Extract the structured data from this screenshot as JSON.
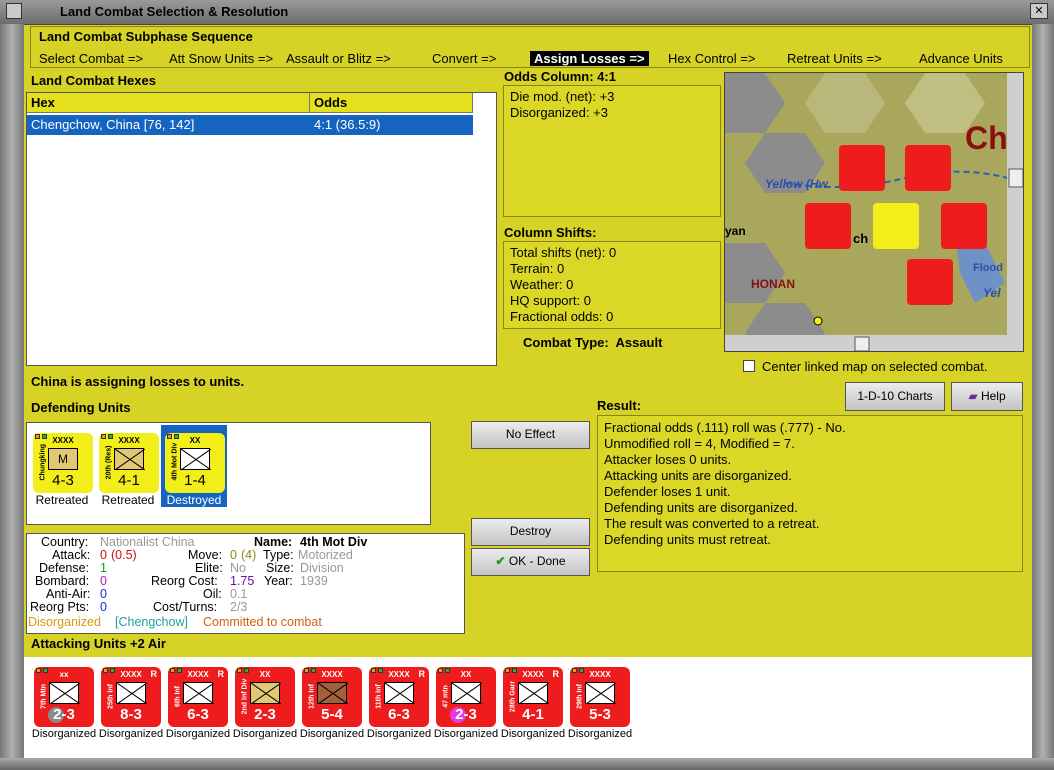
{
  "window": {
    "title": "Land Combat Selection & Resolution"
  },
  "phase": {
    "title": "Land Combat Subphase Sequence",
    "steps": [
      "Select Combat =>",
      "Att Snow Units =>",
      "Assault or Blitz =>",
      "Convert =>",
      "Assign Losses =>",
      "Hex Control =>",
      "Retreat Units =>",
      "Advance Units"
    ],
    "active_index": 4
  },
  "hexes": {
    "title": "Land Combat Hexes",
    "col_hex": "Hex",
    "col_odds": "Odds",
    "row": {
      "hex": "Chengchow, China [76, 142]",
      "odds": "4:1 (36.5:9)"
    }
  },
  "odds": {
    "title": "Odds Column: 4:1",
    "lines": [
      "Die mod. (net): +3",
      "Disorganized: +3"
    ]
  },
  "shifts": {
    "title": "Column Shifts:",
    "lines": [
      "Total shifts (net): 0",
      "Terrain: 0",
      "Weather: 0",
      "HQ support: 0",
      "Fractional odds: 0"
    ]
  },
  "combat_type": {
    "label": "Combat Type:",
    "value": "Assault"
  },
  "map": {
    "labels": [
      "Yellow (Hw",
      "HONAN",
      "Flood",
      "ch",
      "yan",
      "Yel",
      "Ch"
    ],
    "center_checkbox": "Center linked map on selected combat.",
    "center_checked": false
  },
  "status": "China is assigning losses to units.",
  "defending": {
    "title": "Defending Units",
    "units": [
      {
        "name": "Chungking",
        "size": "XXXX",
        "symbol": "M",
        "value": "4-3",
        "status": "Retreated",
        "selected": false
      },
      {
        "name": "20th (Res)",
        "size": "XXXX",
        "symbol": "",
        "value": "4-1",
        "status": "Retreated",
        "selected": false
      },
      {
        "name": "4th Mot Div",
        "size": "XX",
        "symbol": "",
        "value": "1-4",
        "status": "Destroyed",
        "selected": true
      }
    ]
  },
  "buttons": {
    "no_effect": "No Effect",
    "destroy": "Destroy",
    "ok_done": "OK - Done",
    "charts": "1-D-10 Charts",
    "help": "Help"
  },
  "result": {
    "title": "Result:",
    "lines": [
      "Fractional odds (.111) roll was (.777)  - No.",
      "Unmodified roll = 4, Modified = 7.",
      "Attacker loses 0 units.",
      "Attacking units are disorganized.",
      "Defender loses 1 unit.",
      "Defending units are disorganized.",
      "The result was converted to a retreat.",
      "Defending units must retreat."
    ]
  },
  "details": {
    "country_label": "Country:",
    "country": "Nationalist China",
    "name_label": "Name:",
    "name": "4th Mot Div",
    "attack_label": "Attack:",
    "attack": "0",
    "attack_paren": "(0.5)",
    "move_label": "Move:",
    "move": "0",
    "move_paren": "(4)",
    "type_label": "Type:",
    "type": "Motorized",
    "defense_label": "Defense:",
    "defense": "1",
    "elite_label": "Elite:",
    "elite": "No",
    "size_label": "Size:",
    "size": "Division",
    "bombard_label": "Bombard:",
    "bombard": "0",
    "reorg_label": "Reorg Cost:",
    "reorg": "1.75",
    "year_label": "Year:",
    "year": "1939",
    "antiair_label": "Anti-Air:",
    "antiair": "0",
    "oil_label": "Oil:",
    "oil": "0.1",
    "reorgpts_label": "Reorg Pts:",
    "reorgpts": "0",
    "cost_label": "Cost/Turns:",
    "cost": "2/3",
    "footer_a": "Disorganized",
    "footer_b": "[Chengchow]",
    "footer_c": "Committed to combat"
  },
  "attacking": {
    "title": "Attacking Units +2 Air",
    "units": [
      {
        "name": "7th Mtn",
        "size": "xx",
        "value": "2-3",
        "box": "white",
        "status": "Disorganized",
        "badge": "grey"
      },
      {
        "name": "25th Inf",
        "size": "XXXX",
        "value": "8-3",
        "box": "white",
        "status": "Disorganized",
        "r": "R"
      },
      {
        "name": "6th Inf",
        "size": "XXXX",
        "value": "6-3",
        "box": "white",
        "status": "Disorganized",
        "r": "R"
      },
      {
        "name": "2nd Inf Div",
        "size": "XX",
        "value": "2-3",
        "box": "tan",
        "status": "Disorganized"
      },
      {
        "name": "12th Inf",
        "size": "XXXX",
        "value": "5-4",
        "box": "brown",
        "status": "Disorganized"
      },
      {
        "name": "11th Inf",
        "size": "XXXX",
        "value": "6-3",
        "box": "white",
        "status": "Disorganized",
        "r": "R"
      },
      {
        "name": "47 mtn",
        "size": "XX",
        "value": "2-3",
        "box": "white",
        "status": "Disorganized",
        "badge": "pink"
      },
      {
        "name": "28th Garr",
        "size": "XXXX",
        "value": "4-1",
        "box": "white",
        "status": "Disorganized",
        "r": "R"
      },
      {
        "name": "29th Inf",
        "size": "XXXX",
        "value": "5-3",
        "box": "white",
        "status": "Disorganized"
      }
    ]
  },
  "colors": {
    "panel": "#d7d226",
    "select": "#1565c0",
    "red_counter": "#ee1c1c",
    "yellow_counter": "#f2ee1a"
  }
}
